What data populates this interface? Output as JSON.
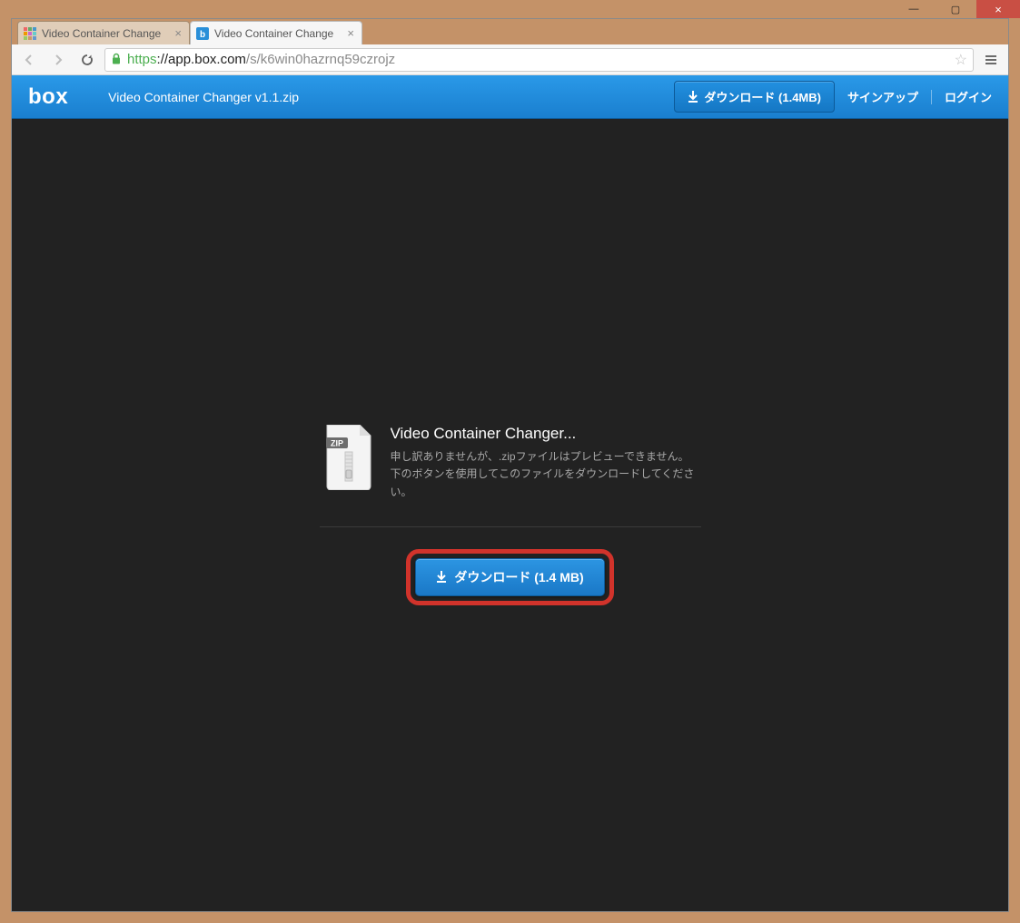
{
  "window": {
    "minimize_glyph": "—",
    "maximize_glyph": "▢",
    "close_glyph": "×"
  },
  "browser": {
    "tabs": [
      {
        "title": "Video Container Change"
      },
      {
        "title": "Video Container Change"
      }
    ],
    "url": {
      "scheme": "https",
      "host": "://app.box.com",
      "path": "/s/k6win0hazrnq59czrojz"
    }
  },
  "box": {
    "logo_text": "box",
    "filename": "Video Container Changer v1.1.zip",
    "download_btn": "ダウンロード (1.4MB)",
    "signup": "サインアップ",
    "login": "ログイン",
    "preview_title": "Video Container Changer...",
    "preview_msg": "申し訳ありませんが、.zipファイルはプレビューできません。下のボタンを使用してこのファイルをダウンロードしてください。",
    "download_big": "ダウンロード (1.4 MB)",
    "zip_badge": "ZIP"
  }
}
